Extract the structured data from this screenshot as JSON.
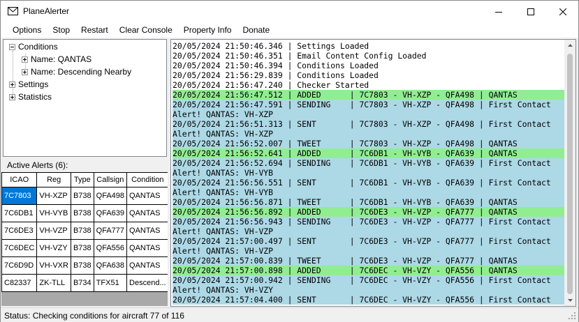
{
  "window": {
    "title": "PlaneAlerter"
  },
  "menu": [
    "Options",
    "Stop",
    "Restart",
    "Clear Console",
    "Property Info",
    "Donate"
  ],
  "tree": {
    "conditions": "Conditions",
    "condition_items": [
      "Name: QANTAS",
      "Name: Descending Nearby"
    ],
    "settings": "Settings",
    "statistics": "Statistics"
  },
  "alerts": {
    "label": "Active Alerts (6):",
    "columns": [
      "ICAO",
      "Reg",
      "Type",
      "Callsign",
      "Condition"
    ],
    "rows": [
      [
        "7C7803",
        "VH-XZP",
        "B738",
        "QFA498",
        "QANTAS"
      ],
      [
        "7C6DB1",
        "VH-VYB",
        "B738",
        "QFA639",
        "QANTAS"
      ],
      [
        "7C6DE3",
        "VH-VZP",
        "B738",
        "QFA777",
        "QANTAS"
      ],
      [
        "7C6DEC",
        "VH-VZY",
        "B738",
        "QFA556",
        "QANTAS"
      ],
      [
        "7C6D9D",
        "VH-VXR",
        "B738",
        "QFA638",
        "QANTAS"
      ],
      [
        "C82337",
        "ZK-TLL",
        "B734",
        "TFX51",
        "Descend..."
      ]
    ]
  },
  "log": [
    {
      "type": "plain",
      "text": "20/05/2024 21:50:46.346 | Settings Loaded"
    },
    {
      "type": "plain",
      "text": "20/05/2024 21:50:46.351 | Email Content Config Loaded"
    },
    {
      "type": "plain",
      "text": "20/05/2024 21:50:46.394 | Conditions Loaded"
    },
    {
      "type": "plain",
      "text": "20/05/2024 21:56:29.839 | Conditions Loaded"
    },
    {
      "type": "plain",
      "text": "20/05/2024 21:56:47.240 | Checker Started"
    },
    {
      "type": "added",
      "text": "20/05/2024 21:56:47.512 | ADDED      | 7C7803 - VH-XZP - QFA498 | QANTAS"
    },
    {
      "type": "sending",
      "text": "20/05/2024 21:56:47.591 | SENDING    | 7C7803 - VH-XZP - QFA498 | First Contact"
    },
    {
      "type": "alert",
      "text": "Alert! QANTAS: VH-XZP"
    },
    {
      "type": "sent",
      "text": "20/05/2024 21:56:51.313 | SENT       | 7C7803 - VH-XZP - QFA498 | First Contact"
    },
    {
      "type": "alert",
      "text": "Alert! QANTAS: VH-XZP"
    },
    {
      "type": "tweet",
      "text": "20/05/2024 21:56:52.007 | TWEET      | 7C7803 - VH-XZP - QFA498 | QANTAS"
    },
    {
      "type": "added",
      "text": "20/05/2024 21:56:52.641 | ADDED      | 7C6DB1 - VH-VYB - QFA639 | QANTAS"
    },
    {
      "type": "sending",
      "text": "20/05/2024 21:56:52.694 | SENDING    | 7C6DB1 - VH-VYB - QFA639 | First Contact"
    },
    {
      "type": "alert",
      "text": "Alert! QANTAS: VH-VYB"
    },
    {
      "type": "sent",
      "text": "20/05/2024 21:56:56.551 | SENT       | 7C6DB1 - VH-VYB - QFA639 | First Contact"
    },
    {
      "type": "alert",
      "text": "Alert! QANTAS: VH-VYB"
    },
    {
      "type": "tweet",
      "text": "20/05/2024 21:56:56.871 | TWEET      | 7C6DB1 - VH-VYB - QFA639 | QANTAS"
    },
    {
      "type": "added",
      "text": "20/05/2024 21:56:56.892 | ADDED      | 7C6DE3 - VH-VZP - QFA777 | QANTAS"
    },
    {
      "type": "sending",
      "text": "20/05/2024 21:56:56.943 | SENDING    | 7C6DE3 - VH-VZP - QFA777 | First Contact"
    },
    {
      "type": "alert",
      "text": "Alert! QANTAS: VH-VZP"
    },
    {
      "type": "sent",
      "text": "20/05/2024 21:57:00.497 | SENT       | 7C6DE3 - VH-VZP - QFA777 | First Contact"
    },
    {
      "type": "alert",
      "text": "Alert! QANTAS: VH-VZP"
    },
    {
      "type": "tweet",
      "text": "20/05/2024 21:57:00.839 | TWEET      | 7C6DE3 - VH-VZP - QFA777 | QANTAS"
    },
    {
      "type": "added",
      "text": "20/05/2024 21:57:00.898 | ADDED      | 7C6DEC - VH-VZY - QFA556 | QANTAS"
    },
    {
      "type": "sending",
      "text": "20/05/2024 21:57:00.942 | SENDING    | 7C6DEC - VH-VZY - QFA556 | First Contact"
    },
    {
      "type": "alert",
      "text": "Alert! QANTAS: VH-VZY"
    },
    {
      "type": "sent",
      "text": "20/05/2024 21:57:04.400 | SENT       | 7C6DEC - VH-VZY - QFA556 | First Contact"
    }
  ],
  "status": {
    "text": "Status: Checking conditions for aircraft 77 of 116"
  },
  "colors": {
    "added": "#90ee90",
    "logged_action": "#add8e6",
    "selected_cell": "#0078d7"
  }
}
